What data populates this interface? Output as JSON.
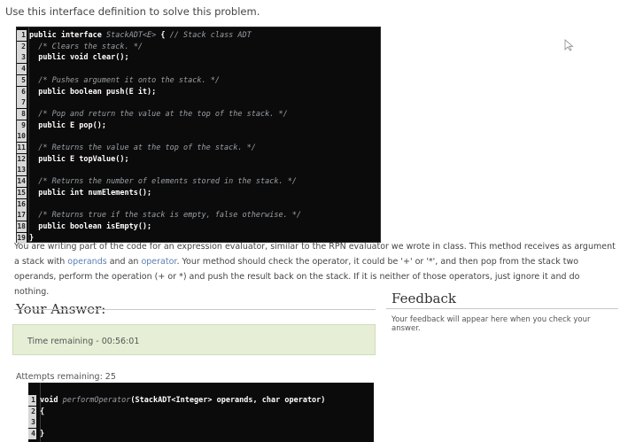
{
  "intro": "Use this interface definition to solve this problem.",
  "interface_code": [
    {
      "n": "1",
      "tokens": [
        {
          "t": "public interface ",
          "c": "kw"
        },
        {
          "t": "StackADT<E>",
          "c": "cm"
        },
        {
          "t": " { ",
          "c": "kw"
        },
        {
          "t": "// Stack class ADT",
          "c": "cm"
        }
      ]
    },
    {
      "n": "2",
      "tokens": [
        {
          "t": "  /* Clears the stack. */",
          "c": "cm"
        }
      ]
    },
    {
      "n": "3",
      "tokens": [
        {
          "t": "  public void clear();",
          "c": "kw"
        }
      ]
    },
    {
      "n": "4",
      "tokens": []
    },
    {
      "n": "5",
      "tokens": [
        {
          "t": "  /* Pushes argument it onto the stack. */",
          "c": "cm"
        }
      ]
    },
    {
      "n": "6",
      "tokens": [
        {
          "t": "  public boolean push(E it);",
          "c": "kw"
        }
      ]
    },
    {
      "n": "7",
      "tokens": []
    },
    {
      "n": "8",
      "tokens": [
        {
          "t": "  /* Pop and return the value at the top of the stack. */",
          "c": "cm"
        }
      ]
    },
    {
      "n": "9",
      "tokens": [
        {
          "t": "  public E pop();",
          "c": "kw"
        }
      ]
    },
    {
      "n": "10",
      "tokens": []
    },
    {
      "n": "11",
      "tokens": [
        {
          "t": "  /* Returns the value at the top of the stack. */",
          "c": "cm"
        }
      ]
    },
    {
      "n": "12",
      "tokens": [
        {
          "t": "  public E topValue();",
          "c": "kw"
        }
      ]
    },
    {
      "n": "13",
      "tokens": []
    },
    {
      "n": "14",
      "tokens": [
        {
          "t": "  /* Returns the number of elements stored in the stack. */",
          "c": "cm"
        }
      ]
    },
    {
      "n": "15",
      "tokens": [
        {
          "t": "  public int numElements();",
          "c": "kw"
        }
      ]
    },
    {
      "n": "16",
      "tokens": []
    },
    {
      "n": "17",
      "tokens": [
        {
          "t": "  /* Returns true if the stack is empty, false otherwise. */",
          "c": "cm"
        }
      ]
    },
    {
      "n": "18",
      "tokens": [
        {
          "t": "  public boolean isEmpty();",
          "c": "kw"
        }
      ]
    },
    {
      "n": "19",
      "tokens": [
        {
          "t": "}",
          "c": "kw"
        }
      ]
    }
  ],
  "description": {
    "part1": "You are writing part of the code for an expression evaluator, similar to the RPN evaluator we wrote in class. This method receives as argument a stack with ",
    "var1": "operands",
    "part2": " and an ",
    "var2": "operator",
    "part3": ". Your method should check the operator, it could be '+' or '*', and then pop from the stack two operands, perform the operation (+ or *) and push the result back on the stack. If it is neither of those operators, just ignore it and do nothing."
  },
  "answer": {
    "title": "Your Answer:",
    "timer": "Time remaining - 00:56:01",
    "attempts": "Attempts remaining: 25",
    "code": [
      {
        "n": "1",
        "tokens": [
          {
            "t": "void ",
            "c": "kw"
          },
          {
            "t": "performOperator",
            "c": "cm"
          },
          {
            "t": "(StackADT<Integer> operands, char operator)",
            "c": "kw"
          }
        ]
      },
      {
        "n": "2",
        "tokens": [
          {
            "t": "{",
            "c": "kw"
          }
        ]
      },
      {
        "n": "3",
        "tokens": []
      },
      {
        "n": "4",
        "tokens": [
          {
            "t": "}",
            "c": "kw"
          }
        ]
      }
    ]
  },
  "feedback": {
    "title": "Feedback",
    "text": "Your feedback will appear here when you check your answer."
  },
  "icons": {
    "cursor": "mouse-pointer-icon"
  }
}
